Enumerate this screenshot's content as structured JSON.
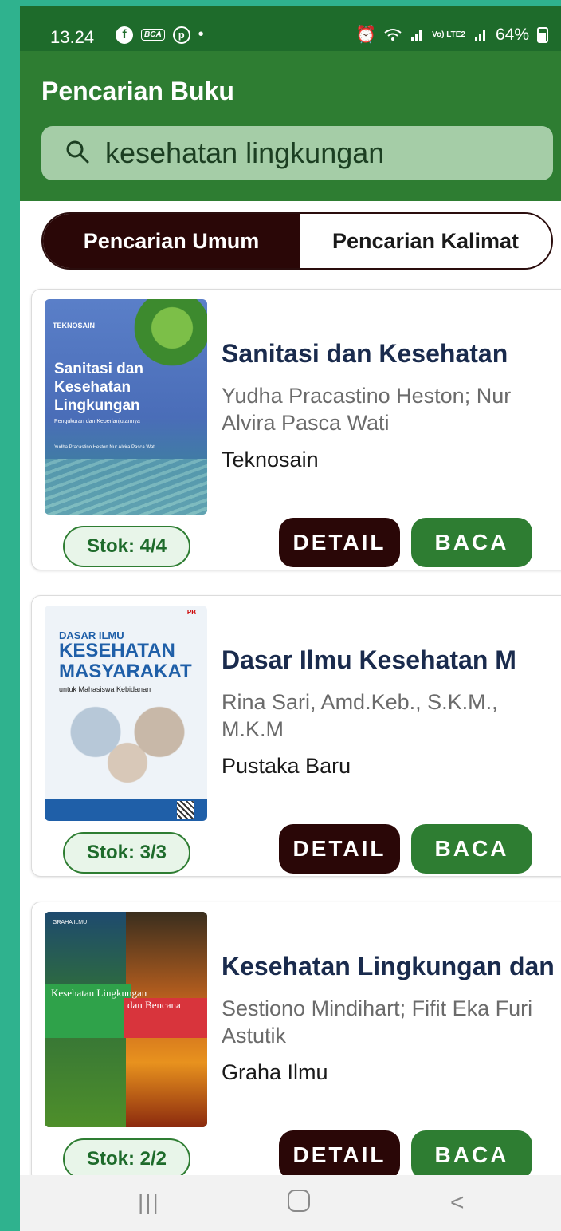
{
  "status_bar": {
    "time": "13.24",
    "left_icons": [
      "facebook-icon",
      "bca-mobile-icon",
      "pinterest-icon",
      "dot-icon"
    ],
    "battery": "64%",
    "network": "Vo) LTE2"
  },
  "app_bar": {
    "title": "Pencarian Buku",
    "search_value": "kesehatan lingkungan",
    "search_icon": "search-icon"
  },
  "tabs": [
    {
      "label": "Pencarian Umum",
      "active": true
    },
    {
      "label": "Pencarian Kalimat",
      "active": false
    }
  ],
  "books": [
    {
      "title": "Sanitasi dan Kesehatan",
      "author": "Yudha Pracastino Heston; Nur Alvira Pasca Wati",
      "publisher": "Teknosain",
      "stock": "Stok: 4/4",
      "detail_label": "DETAIL",
      "read_label": "BACA",
      "cover": {
        "publisher": "TEKNOSAIN",
        "title": "Sanitasi dan Kesehatan Lingkungan",
        "subtitle": "Pengukuran dan Keberlanjutannya",
        "authors": "Yudha Pracastino Heston Nur Alvira Pasca Wati"
      }
    },
    {
      "title": "Dasar Ilmu Kesehatan M",
      "author": "Rina Sari, Amd.Keb., S.K.M., M.K.M",
      "publisher": "Pustaka Baru",
      "stock": "Stok: 3/3",
      "detail_label": "DETAIL",
      "read_label": "BACA",
      "cover": {
        "line1": "DASAR ILMU",
        "line2": "KESEHATAN MASYARAKAT",
        "line3": "untuk Mahasiswa Kebidanan",
        "badge": "PB"
      }
    },
    {
      "title": "Kesehatan Lingkungan dan Bencana",
      "author": "Sestiono Mindihart; Fifit Eka Furi Astutik",
      "publisher": "Graha Ilmu",
      "stock": "Stok: 2/2",
      "detail_label": "DETAIL",
      "read_label": "BACA",
      "cover": {
        "publisher": "GRAHA ILMU",
        "left_title": "Kesehatan Lingkungan",
        "right_title": "dan Bencana"
      }
    }
  ],
  "nav_bar": {
    "recents": "|||",
    "back": "<"
  },
  "colors": {
    "primary_green": "#2E7D32",
    "dark_green": "#1E6B2B",
    "dark_maroon": "#2A0707",
    "background": "#2FB28E"
  }
}
